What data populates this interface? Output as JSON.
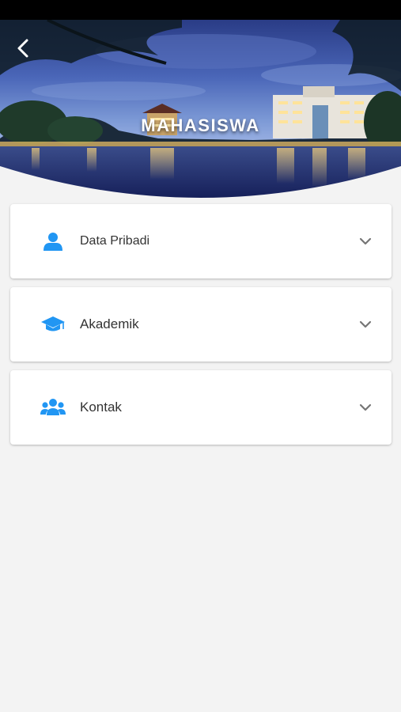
{
  "header": {
    "title": "MAHASISWA",
    "back_icon": "chevron-left-icon"
  },
  "sections": [
    {
      "label": "Data Pribadi",
      "icon": "person-icon",
      "expand_icon": "chevron-down-icon"
    },
    {
      "label": "Akademik",
      "icon": "graduation-cap-icon",
      "expand_icon": "chevron-down-icon"
    },
    {
      "label": "Kontak",
      "icon": "users-icon",
      "expand_icon": "chevron-down-icon"
    }
  ],
  "colors": {
    "accent": "#2196f3",
    "background": "#f3f3f3",
    "card": "#ffffff",
    "text": "#333333",
    "chevron": "#757575"
  }
}
